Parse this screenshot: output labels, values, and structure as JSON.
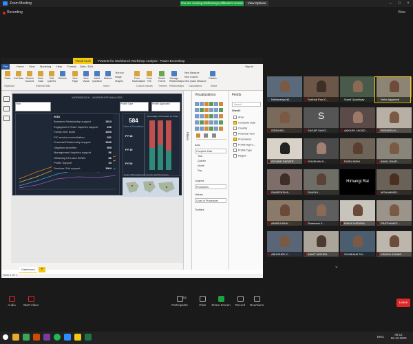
{
  "window": {
    "title": "Zoom Meeting",
    "share_banner": "You are viewing Nishimanya dilbeula's screen",
    "view_options": "View Options",
    "recording": "Recording",
    "view": "View"
  },
  "pbi": {
    "title": "PowerBI for Workbench Workshop Analysis - Power BI Desktop",
    "tab_context": "Visual tools",
    "sign_in": "Sign in",
    "menu": [
      "File",
      "Home",
      "View",
      "Modeling",
      "Help",
      "Format",
      "Data / Drill"
    ],
    "ribbon": [
      "Paste",
      "Get Data",
      "Recent Sources",
      "Enter Data",
      "Edit Queries",
      "Refresh",
      "New Page",
      "New Visual",
      "Ask A Question",
      "Buttons",
      "Text box",
      "Image",
      "Shapes",
      "From Marketplace",
      "From File",
      "Switch Theme",
      "Manage Relationships",
      "New Measure",
      "New Column",
      "New Quick Measure",
      "Publish"
    ],
    "ribbon_groups": [
      "Clipboard",
      "External data",
      "Insert",
      "Custom visuals",
      "Themes",
      "Relationships",
      "Calculations",
      "Share"
    ],
    "report_title": "WORKBENCH - WORKSHOP ANALYSIS",
    "slicers": [
      "Year",
      "Profile Type",
      "Profile Approved"
    ],
    "kpi_year": "2018",
    "services": [
      {
        "name": "Business Relationship support",
        "value": "1513"
      },
      {
        "name": "Engagement Team Inquiries support",
        "value": "226"
      },
      {
        "name": "Family Inter Build",
        "value": "1393"
      },
      {
        "name": "FIC service reconciliation",
        "value": "281"
      },
      {
        "name": "Financial Relationship support",
        "value": "1549"
      },
      {
        "name": "Litigation searches",
        "value": "565"
      },
      {
        "name": "Management Inquiries support",
        "value": "56"
      },
      {
        "name": "Obtaining ECs and SOWs",
        "value": "86"
      },
      {
        "name": "Profile Support",
        "value": "33"
      },
      {
        "name": "Services Grid support",
        "value": "1904"
      }
    ],
    "count_val": "584",
    "count_label": "Count of Procedures",
    "bar_chart_title": "Percentage of Procedure by Financial Year and Area",
    "map_title": "Count of Procedures by Country and Procedures",
    "fy_labels": [
      "FY'18",
      "FY'19",
      "FY'20"
    ],
    "page_tab": "Dashboard",
    "page_info": "PAGE 1 OF 1",
    "viz_pane": "Visualizations",
    "filters_pane": "Filters",
    "fields_pane": "Fields",
    "search": "Search",
    "wells": {
      "axis": "Axis",
      "axis_items": [
        "Complete Date",
        "Year",
        "Quarter",
        "Month",
        "Day"
      ],
      "legend": "Legend",
      "legend_item": "Procedures",
      "values": "Values",
      "values_item": "Count of Procedures",
      "tooltips": "Tooltips"
    },
    "fields": {
      "table": "Sheet1",
      "items": [
        "Area",
        "Complete Date",
        "Country",
        "Financial Year",
        "Procedures",
        "Profile Appro...",
        "Profile Type",
        "Region"
      ]
    }
  },
  "participants": [
    {
      "name": "Nishimanya dil..."
    },
    {
      "name": "Sarthak Paul C..."
    },
    {
      "name": "Sumit Upadhyay"
    },
    {
      "name": "Nehe Aggarwal"
    },
    {
      "name": "SIDDHAR..."
    },
    {
      "name": "SAGAR SAHG..."
    },
    {
      "name": "AAKASH JAGAD..."
    },
    {
      "name": "RISHIDEV K..."
    },
    {
      "name": "GOVIND SARATE"
    },
    {
      "name": "SHUBHAM K..."
    },
    {
      "name": "PURU NIDHI"
    },
    {
      "name": "AKHIL SHAR..."
    },
    {
      "name": "SAMEEKSHA..."
    },
    {
      "name": "SHASHI..."
    },
    {
      "name": "Himangi Rai"
    },
    {
      "name": "MOHAMMED..."
    },
    {
      "name": "ANINDA BHA..."
    },
    {
      "name": "Shashank K..."
    },
    {
      "name": "RAKHI KATARIA"
    },
    {
      "name": "PRATHAMES..."
    },
    {
      "name": "ABHISHEK K..."
    },
    {
      "name": "ANKIT MISHRA"
    },
    {
      "name": "SHUBHAM SH..."
    },
    {
      "name": "VIKASH KUMAR"
    }
  ],
  "toolbar": {
    "audio": "Audio",
    "video": "Start Video",
    "participants": "Participants",
    "participant_count": "52",
    "chat": "Chat",
    "share": "Share Screen",
    "record": "Record",
    "reactions": "Reactions",
    "leave": "Leave"
  },
  "taskbar": {
    "time": "09:12",
    "date": "18-10-2020",
    "lang": "ENG"
  }
}
